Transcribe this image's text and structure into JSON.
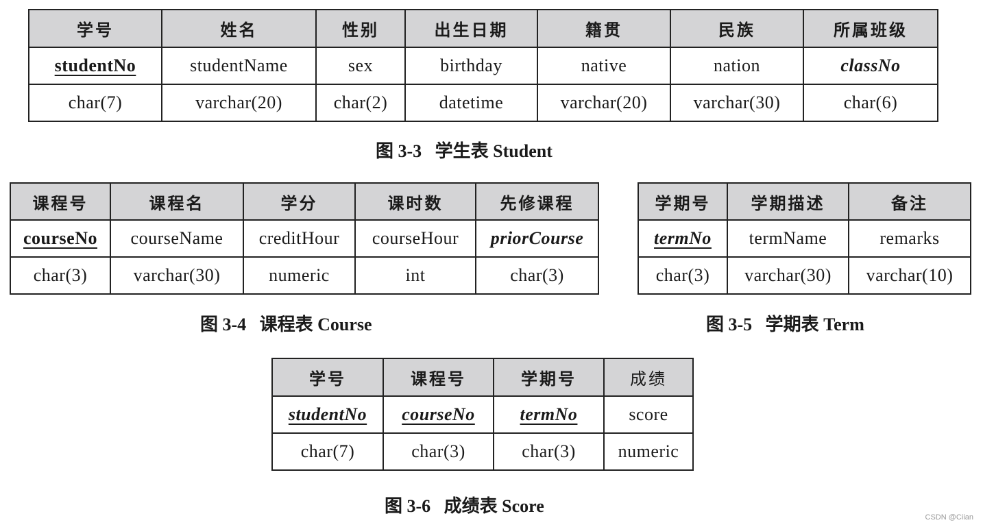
{
  "student": {
    "caption": "图 3-3   学生表 Student",
    "headers": [
      "学号",
      "姓名",
      "性别",
      "出生日期",
      "籍贯",
      "民族",
      "所属班级"
    ],
    "fields": [
      "studentNo",
      "studentName",
      "sex",
      "birthday",
      "native",
      "nation",
      "classNo"
    ],
    "types": [
      "char(7)",
      "varchar(20)",
      "char(2)",
      "datetime",
      "varchar(20)",
      "varchar(30)",
      "char(6)"
    ]
  },
  "course": {
    "caption": "图 3-4   课程表 Course",
    "headers": [
      "课程号",
      "课程名",
      "学分",
      "课时数",
      "先修课程"
    ],
    "fields": [
      "courseNo",
      "courseName",
      "creditHour",
      "courseHour",
      "priorCourse"
    ],
    "types": [
      "char(3)",
      "varchar(30)",
      "numeric",
      "int",
      "char(3)"
    ]
  },
  "term": {
    "caption": "图 3-5   学期表 Term",
    "headers": [
      "学期号",
      "学期描述",
      "备注"
    ],
    "fields": [
      "termNo",
      "termName",
      "remarks"
    ],
    "types": [
      "char(3)",
      "varchar(30)",
      "varchar(10)"
    ]
  },
  "score": {
    "caption": "图 3-6   成绩表 Score",
    "headers": [
      "学号",
      "课程号",
      "学期号",
      "成绩"
    ],
    "fields": [
      "studentNo",
      "courseNo",
      "termNo",
      "score"
    ],
    "types": [
      "char(7)",
      "char(3)",
      "char(3)",
      "numeric"
    ]
  },
  "watermark": "CSDN @Ciian"
}
